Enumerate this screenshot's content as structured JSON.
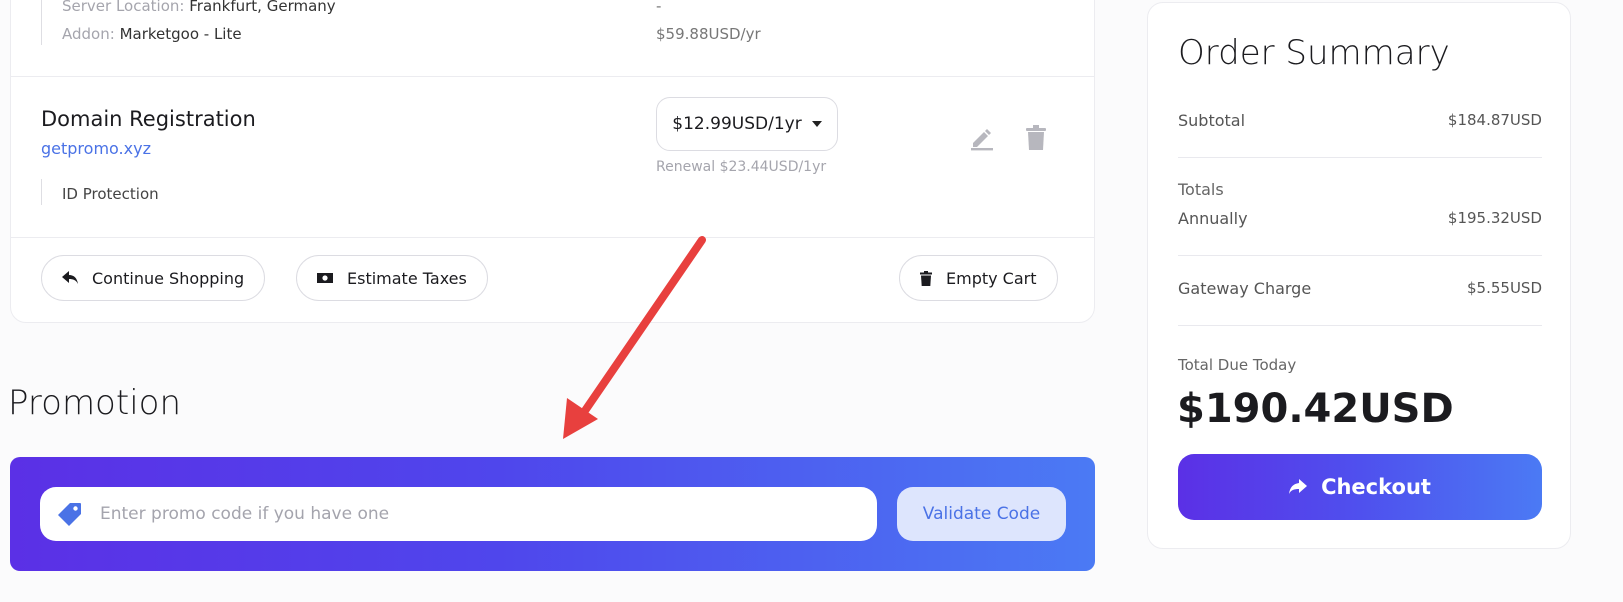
{
  "cart": {
    "product": {
      "server_location_label": "Server Location:",
      "server_location_value": "Frankfurt, Germany",
      "server_location_price": "-",
      "addon_label": "Addon:",
      "addon_value": "Marketgoo - Lite",
      "addon_price": "$59.88USD/yr"
    },
    "domain": {
      "title": "Domain Registration",
      "name": "getpromo.xyz",
      "price_selected": "$12.99USD/1yr",
      "renewal": "Renewal $23.44USD/1yr",
      "addon": "ID Protection"
    },
    "buttons": {
      "continue_shopping": "Continue Shopping",
      "estimate_taxes": "Estimate Taxes",
      "empty_cart": "Empty Cart"
    }
  },
  "promotion": {
    "title": "Promotion",
    "input_placeholder": "Enter promo code if you have one",
    "validate_label": "Validate Code"
  },
  "summary": {
    "title": "Order Summary",
    "subtotal_label": "Subtotal",
    "subtotal_value": "$184.87USD",
    "totals_label": "Totals",
    "annually_label": "Annually",
    "annually_value": "$195.32USD",
    "gateway_label": "Gateway Charge",
    "gateway_value": "$5.55USD",
    "total_due_label": "Total Due Today",
    "total_due_value": "$190.42USD",
    "checkout_label": "Checkout"
  },
  "colors": {
    "accent_blue": "#4a72e6",
    "gradient_start": "#5b30e6",
    "gradient_end": "#4b7af4",
    "annotation_arrow": "#e8403e"
  }
}
